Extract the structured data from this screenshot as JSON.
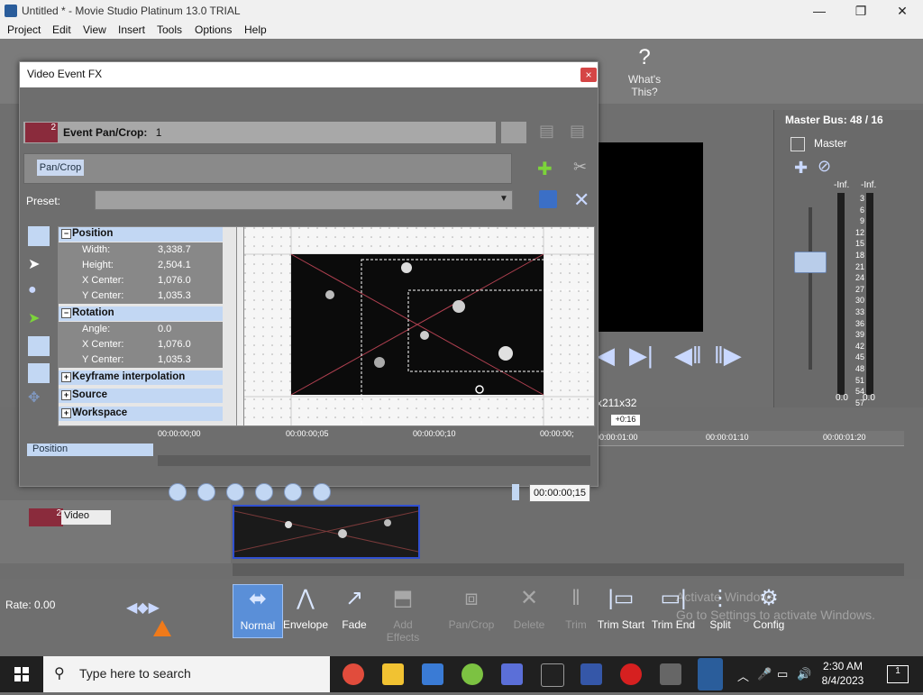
{
  "app": {
    "title": "Untitled * - Movie Studio Platinum 13.0 TRIAL",
    "window_controls": [
      "—",
      "❐",
      "✕"
    ]
  },
  "menu": [
    "Project",
    "Edit",
    "View",
    "Insert",
    "Tools",
    "Options",
    "Help"
  ],
  "toolbar": {
    "whats_this": "What's This?"
  },
  "dialog": {
    "title": "Video Event FX",
    "close": "×",
    "chain_num": "2",
    "event_label": "Event Pan/Crop:",
    "event_value": "1",
    "plugin": "Pan/Crop",
    "preset_label": "Preset:",
    "preset_value": "",
    "groups": {
      "position": "Position",
      "rotation": "Rotation",
      "keyframe": "Keyframe interpolation",
      "source": "Source",
      "workspace": "Workspace"
    },
    "props": {
      "width": {
        "k": "Width:",
        "v": "3,338.7"
      },
      "height": {
        "k": "Height:",
        "v": "2,504.1"
      },
      "xcenter": {
        "k": "X Center:",
        "v": "1,076.0"
      },
      "ycenter": {
        "k": "Y Center:",
        "v": "1,035.3"
      },
      "angle": {
        "k": "Angle:",
        "v": "0.0"
      },
      "rxcenter": {
        "k": "X Center:",
        "v": "1,076.0"
      },
      "rycenter": {
        "k": "Y Center:",
        "v": "1,035.3"
      }
    },
    "keyframe_row": "Position",
    "ruler": [
      "00:00:00;00",
      "00:00:00;05",
      "00:00:00;10",
      "00:00:00;"
    ],
    "time": "00:00:00;15"
  },
  "preview": {
    "info": "x211x32"
  },
  "master": {
    "title": "Master Bus: 48 / 16",
    "label": "Master",
    "inf_left": "-Inf.",
    "inf_right": "-Inf.",
    "scale": [
      "3",
      "6",
      "9",
      "12",
      "15",
      "18",
      "21",
      "24",
      "27",
      "30",
      "33",
      "36",
      "39",
      "42",
      "45",
      "48",
      "51",
      "54",
      "57"
    ],
    "bottom_left": "0.0",
    "bottom_right": "0.0"
  },
  "timeline": {
    "marker": "+0:16",
    "ruler": [
      "00:00:01:00",
      "00:00:01:10",
      "00:00:01:20"
    ],
    "track": {
      "num": "2",
      "name": "Video"
    }
  },
  "bottom": {
    "rate": "Rate: 0.00",
    "tools": [
      {
        "label": "Normal"
      },
      {
        "label": "Envelope"
      },
      {
        "label": "Fade"
      },
      {
        "label": "Add Effects"
      },
      {
        "label": "Pan/Crop"
      },
      {
        "label": "Delete"
      },
      {
        "label": "Trim"
      },
      {
        "label": "Trim Start"
      },
      {
        "label": "Trim End"
      },
      {
        "label": "Split"
      },
      {
        "label": "Config"
      }
    ],
    "watermark_1": "Activate Windows",
    "watermark_2": "Go to Settings to activate Windows."
  },
  "taskbar": {
    "search_placeholder": "Type here to search",
    "time": "2:30 AM",
    "date": "8/4/2023",
    "notification_count": "1"
  }
}
